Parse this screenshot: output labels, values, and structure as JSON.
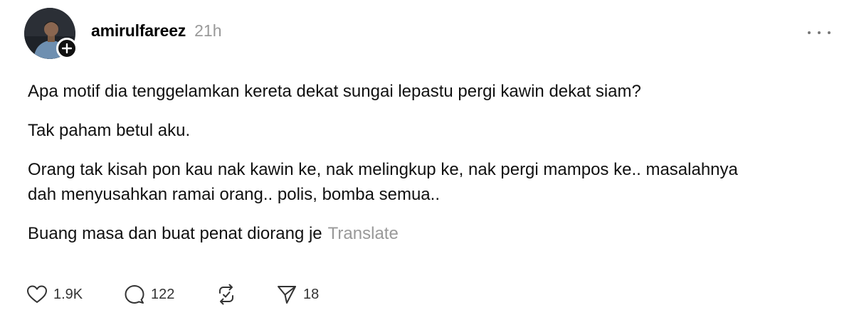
{
  "post": {
    "author": {
      "username": "amirulfareez",
      "timestamp": "21h",
      "avatar_icon": "user-avatar",
      "follow_icon": "plus-icon"
    },
    "menu_icon": "more-icon",
    "paragraphs": [
      "Apa motif dia tenggelamkan kereta dekat sungai lepastu pergi kawin dekat siam?",
      "Tak paham betul aku.",
      "Orang tak kisah pon kau nak kawin ke, nak melingkup ke, nak pergi mampos ke.. masalahnya dah menyusahkan ramai orang.. polis, bomba semua..",
      "Buang masa dan buat penat diorang je"
    ],
    "translate_label": "Translate",
    "actions": {
      "likes": "1.9K",
      "replies": "122",
      "reposts": "",
      "shares": "18"
    }
  },
  "colors": {
    "text": "#111111",
    "muted": "#999999",
    "icon": "#333333",
    "badge": "#101010"
  }
}
